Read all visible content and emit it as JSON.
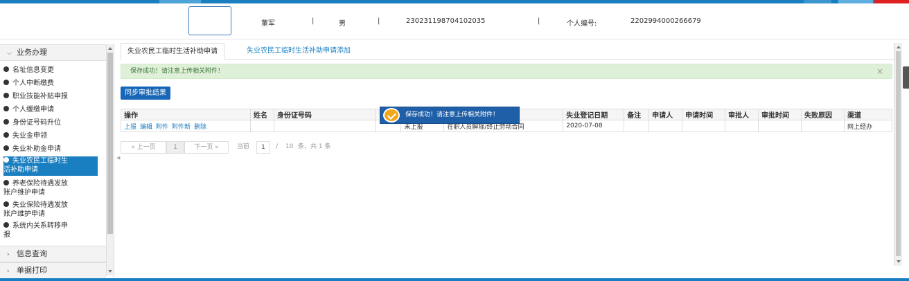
{
  "header": {
    "name": "董军",
    "sep1": "|",
    "gender": "男",
    "sep2": "|",
    "id_number": "230231198704102035",
    "sep3": "|",
    "person_no_label": "个人编号:",
    "person_no": "2202994000266679"
  },
  "sidebar": {
    "section_business": "业务办理",
    "items": [
      {
        "label": "名址信息变更"
      },
      {
        "label": "个人中断缴费"
      },
      {
        "label": "职业技能补贴申报"
      },
      {
        "label": "个人缓缴申请"
      },
      {
        "label": "身份证号码升位"
      },
      {
        "label": "失业金申领"
      },
      {
        "label": "失业补助金申请"
      },
      {
        "label_line1": "失业农民工临时生",
        "label_line2": "活补助申请"
      },
      {
        "label_line1": "养老保险待遇发放",
        "label_line2": "账户维护申请"
      },
      {
        "label_line1": "失业保险待遇发放",
        "label_line2": "账户维护申请"
      },
      {
        "label_line1": "系统内关系转移申",
        "label_line2": "报"
      }
    ],
    "section_query": "信息查询",
    "section_print": "单据打印"
  },
  "tabs": [
    {
      "label": "失业农民工临时生活补助申请"
    },
    {
      "label": "失业农民工临时生活补助申请添加"
    }
  ],
  "alert": {
    "message": "保存成功！请注意上传相关附件！",
    "close": "×"
  },
  "sync_button": "同步审批结果",
  "table": {
    "headers": [
      "操作",
      "姓名",
      "身份证号码",
      "",
      "",
      "",
      "失业登记日期",
      "备注",
      "申请人",
      "申请时间",
      "审批人",
      "审批时间",
      "失败原因",
      "渠道"
    ],
    "row": {
      "actions": [
        "上报",
        "编辑",
        "附件",
        "附件新",
        "删除"
      ],
      "name": "",
      "id_number": "",
      "status": "未上报",
      "reason": "在职人员解除/终止劳动合同",
      "reg_date": "2020-07-08",
      "remark": "",
      "applicant": "",
      "apply_time": "",
      "approver": "",
      "approve_time": "",
      "fail_reason": "",
      "channel": "网上经办"
    }
  },
  "pager": {
    "prev": "« 上一页",
    "page": "1",
    "next": "下一页 »",
    "current_label": "当前",
    "current_value": "1",
    "slash": "/",
    "per_page": "10",
    "summary": "条，共 1 条"
  },
  "toast": {
    "message": "保存成功！请注意上传相关附件！"
  },
  "colors": {
    "primary": "#1a7fc1",
    "button": "#1866b8",
    "alert_bg": "#dff0d8",
    "toast_bg": "#1f5fa8",
    "toast_icon": "#f2a61a"
  }
}
